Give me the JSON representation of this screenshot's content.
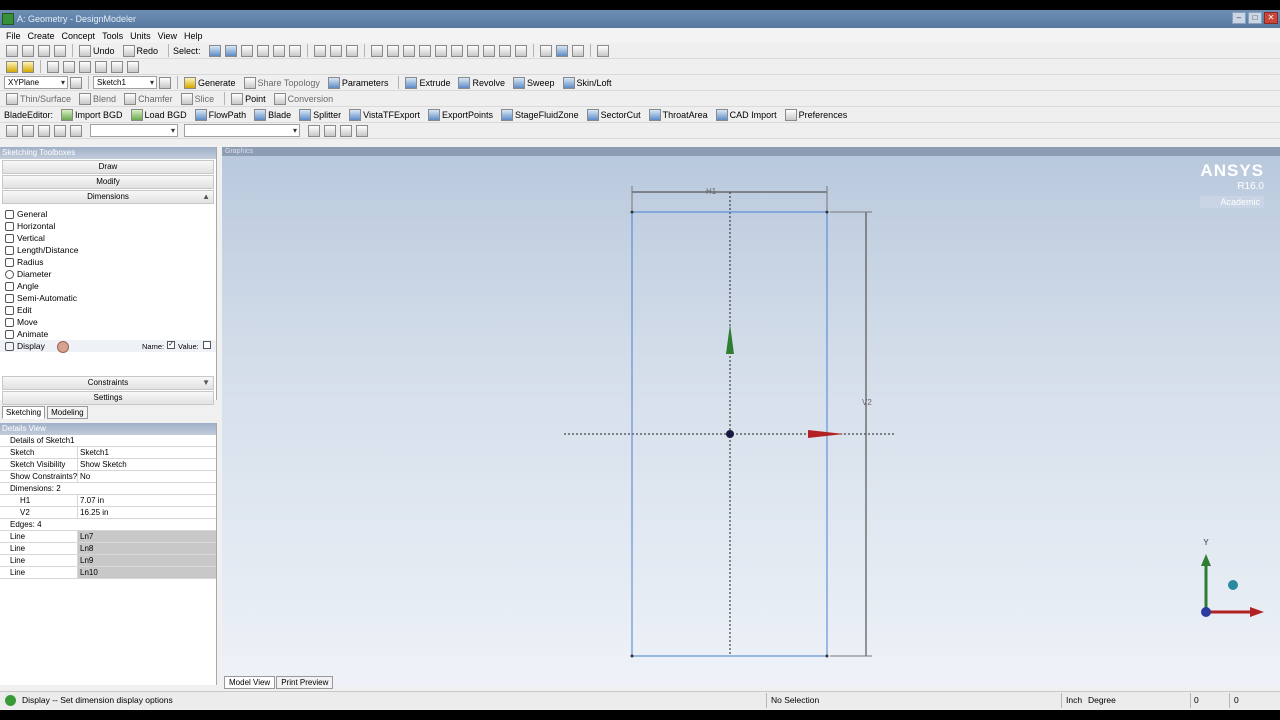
{
  "window": {
    "title": "A: Geometry - DesignModeler"
  },
  "menu": [
    "File",
    "Create",
    "Concept",
    "Tools",
    "Units",
    "View",
    "Help"
  ],
  "toolbar1": {
    "undo": "Undo",
    "redo": "Redo",
    "select": "Select:"
  },
  "toolbar3": {
    "plane": "XYPlane",
    "sketch": "Sketch1",
    "generate": "Generate",
    "share_topology": "Share Topology",
    "parameters": "Parameters",
    "extrude": "Extrude",
    "revolve": "Revolve",
    "sweep": "Sweep",
    "skinloft": "Skin/Loft"
  },
  "toolbar4": {
    "thin_surface": "Thin/Surface",
    "blend": "Blend",
    "chamfer": "Chamfer",
    "slice": "Slice",
    "point": "Point",
    "conversion": "Conversion"
  },
  "blade_toolbar": {
    "label": "BladeEditor:",
    "import_bgd": "Import BGD",
    "load_bgd": "Load BGD",
    "flowpath": "FlowPath",
    "blade": "Blade",
    "splitter": "Splitter",
    "vistatf": "VistaTFExport",
    "export_points": "ExportPoints",
    "stage_fluid": "StageFluidZone",
    "sector_cut": "SectorCut",
    "throat_area": "ThroatArea",
    "cad_import": "CAD Import",
    "preferences": "Preferences"
  },
  "toolbox": {
    "header": "Sketching Toolboxes",
    "sections": {
      "draw": "Draw",
      "modify": "Modify",
      "dimensions": "Dimensions",
      "constraints": "Constraints",
      "settings": "Settings"
    },
    "tools": [
      "General",
      "Horizontal",
      "Vertical",
      "Length/Distance",
      "Radius",
      "Diameter",
      "Angle",
      "Semi-Automatic",
      "Edit",
      "Move",
      "Animate",
      "Display"
    ],
    "display_name_label": "Name:",
    "display_value_label": "Value:"
  },
  "mode_tabs": {
    "sketching": "Sketching",
    "modeling": "Modeling"
  },
  "details": {
    "header": "Details View",
    "title": "Details of Sketch1",
    "rows": [
      {
        "k": "Sketch",
        "v": "Sketch1"
      },
      {
        "k": "Sketch Visibility",
        "v": "Show Sketch"
      },
      {
        "k": "Show Constraints?",
        "v": "No"
      }
    ],
    "dims_group": "Dimensions: 2",
    "dims": [
      {
        "k": "H1",
        "v": "7.07 in"
      },
      {
        "k": "V2",
        "v": "16.25 in"
      }
    ],
    "edges_group": "Edges: 4",
    "edges": [
      {
        "k": "Line",
        "v": "Ln7"
      },
      {
        "k": "Line",
        "v": "Ln8"
      },
      {
        "k": "Line",
        "v": "Ln9"
      },
      {
        "k": "Line",
        "v": "Ln10"
      }
    ]
  },
  "graphics": {
    "header": "Graphics",
    "brand": "ANSYS",
    "release": "R16.0",
    "edition": "Academic",
    "dim_h": "H1",
    "dim_v": "V2",
    "axis_y": "Y"
  },
  "view_tabs": {
    "model_view": "Model View",
    "print_preview": "Print Preview"
  },
  "status": {
    "message": "Display -- Set dimension display options",
    "selection": "No Selection",
    "units_length": "Inch",
    "units_angle": "Degree",
    "val1": "0",
    "val2": "0"
  },
  "colors": {
    "accent": "#5b7fa6",
    "sketch_line": "#4a7fd4",
    "axis_x": "#b22222",
    "axis_y": "#2e7d32"
  }
}
